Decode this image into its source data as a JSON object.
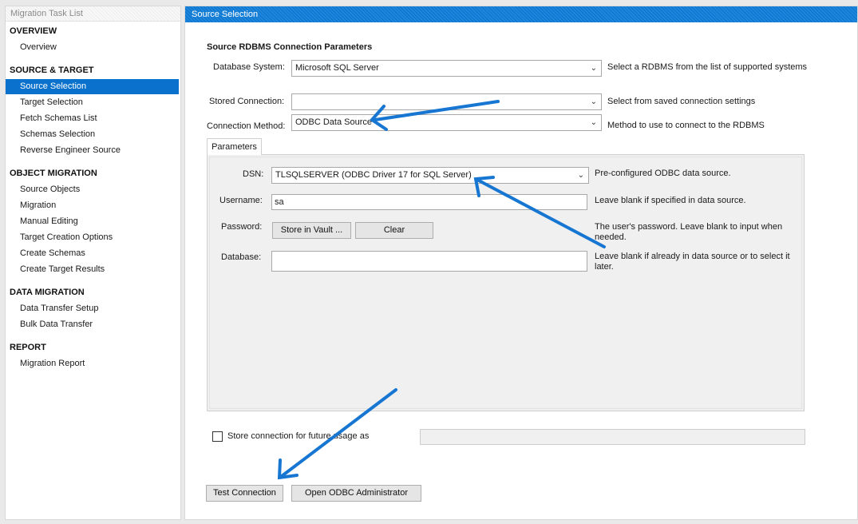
{
  "sidebar": {
    "title": "Migration Task List",
    "sections": [
      {
        "heading": "OVERVIEW",
        "items": [
          "Overview"
        ]
      },
      {
        "heading": "SOURCE & TARGET",
        "items": [
          "Source Selection",
          "Target Selection",
          "Fetch Schemas List",
          "Schemas Selection",
          "Reverse Engineer Source"
        ]
      },
      {
        "heading": "OBJECT MIGRATION",
        "items": [
          "Source Objects",
          "Migration",
          "Manual Editing",
          "Target Creation Options",
          "Create Schemas",
          "Create Target Results"
        ]
      },
      {
        "heading": "DATA MIGRATION",
        "items": [
          "Data Transfer Setup",
          "Bulk Data Transfer"
        ]
      },
      {
        "heading": "REPORT",
        "items": [
          "Migration Report"
        ]
      }
    ],
    "selected_item": "Source Selection"
  },
  "main": {
    "title": "Source Selection",
    "group_title": "Source RDBMS Connection Parameters",
    "database_system": {
      "label": "Database System:",
      "value": "Microsoft SQL Server",
      "hint": "Select a RDBMS from the list of supported systems"
    },
    "stored_connection": {
      "label": "Stored Connection:",
      "value": "",
      "hint": "Select from saved connection settings"
    },
    "connection_method": {
      "label": "Connection Method:",
      "value": "ODBC Data Source",
      "hint": "Method to use to connect to the RDBMS"
    },
    "tab_label": "Parameters",
    "dsn": {
      "label": "DSN:",
      "value": "TLSQLSERVER (ODBC Driver 17 for SQL Server)",
      "hint": "Pre-configured ODBC data source."
    },
    "username": {
      "label": "Username:",
      "value": "sa",
      "hint": "Leave blank if specified in data source."
    },
    "password": {
      "label": "Password:",
      "store_button": "Store in Vault ...",
      "clear_button": "Clear",
      "hint": "The user's password. Leave blank to input when needed."
    },
    "database": {
      "label": "Database:",
      "value": "",
      "hint": "Leave blank if already in data source or to select it later."
    },
    "store_connection_label": "Store connection for future usage as",
    "store_connection_checked": false,
    "test_connection_button": "Test Connection",
    "odbc_admin_button": "Open ODBC Administrator"
  },
  "colors": {
    "accent": "#0a72cc",
    "annotation_arrow": "#1676d2"
  }
}
